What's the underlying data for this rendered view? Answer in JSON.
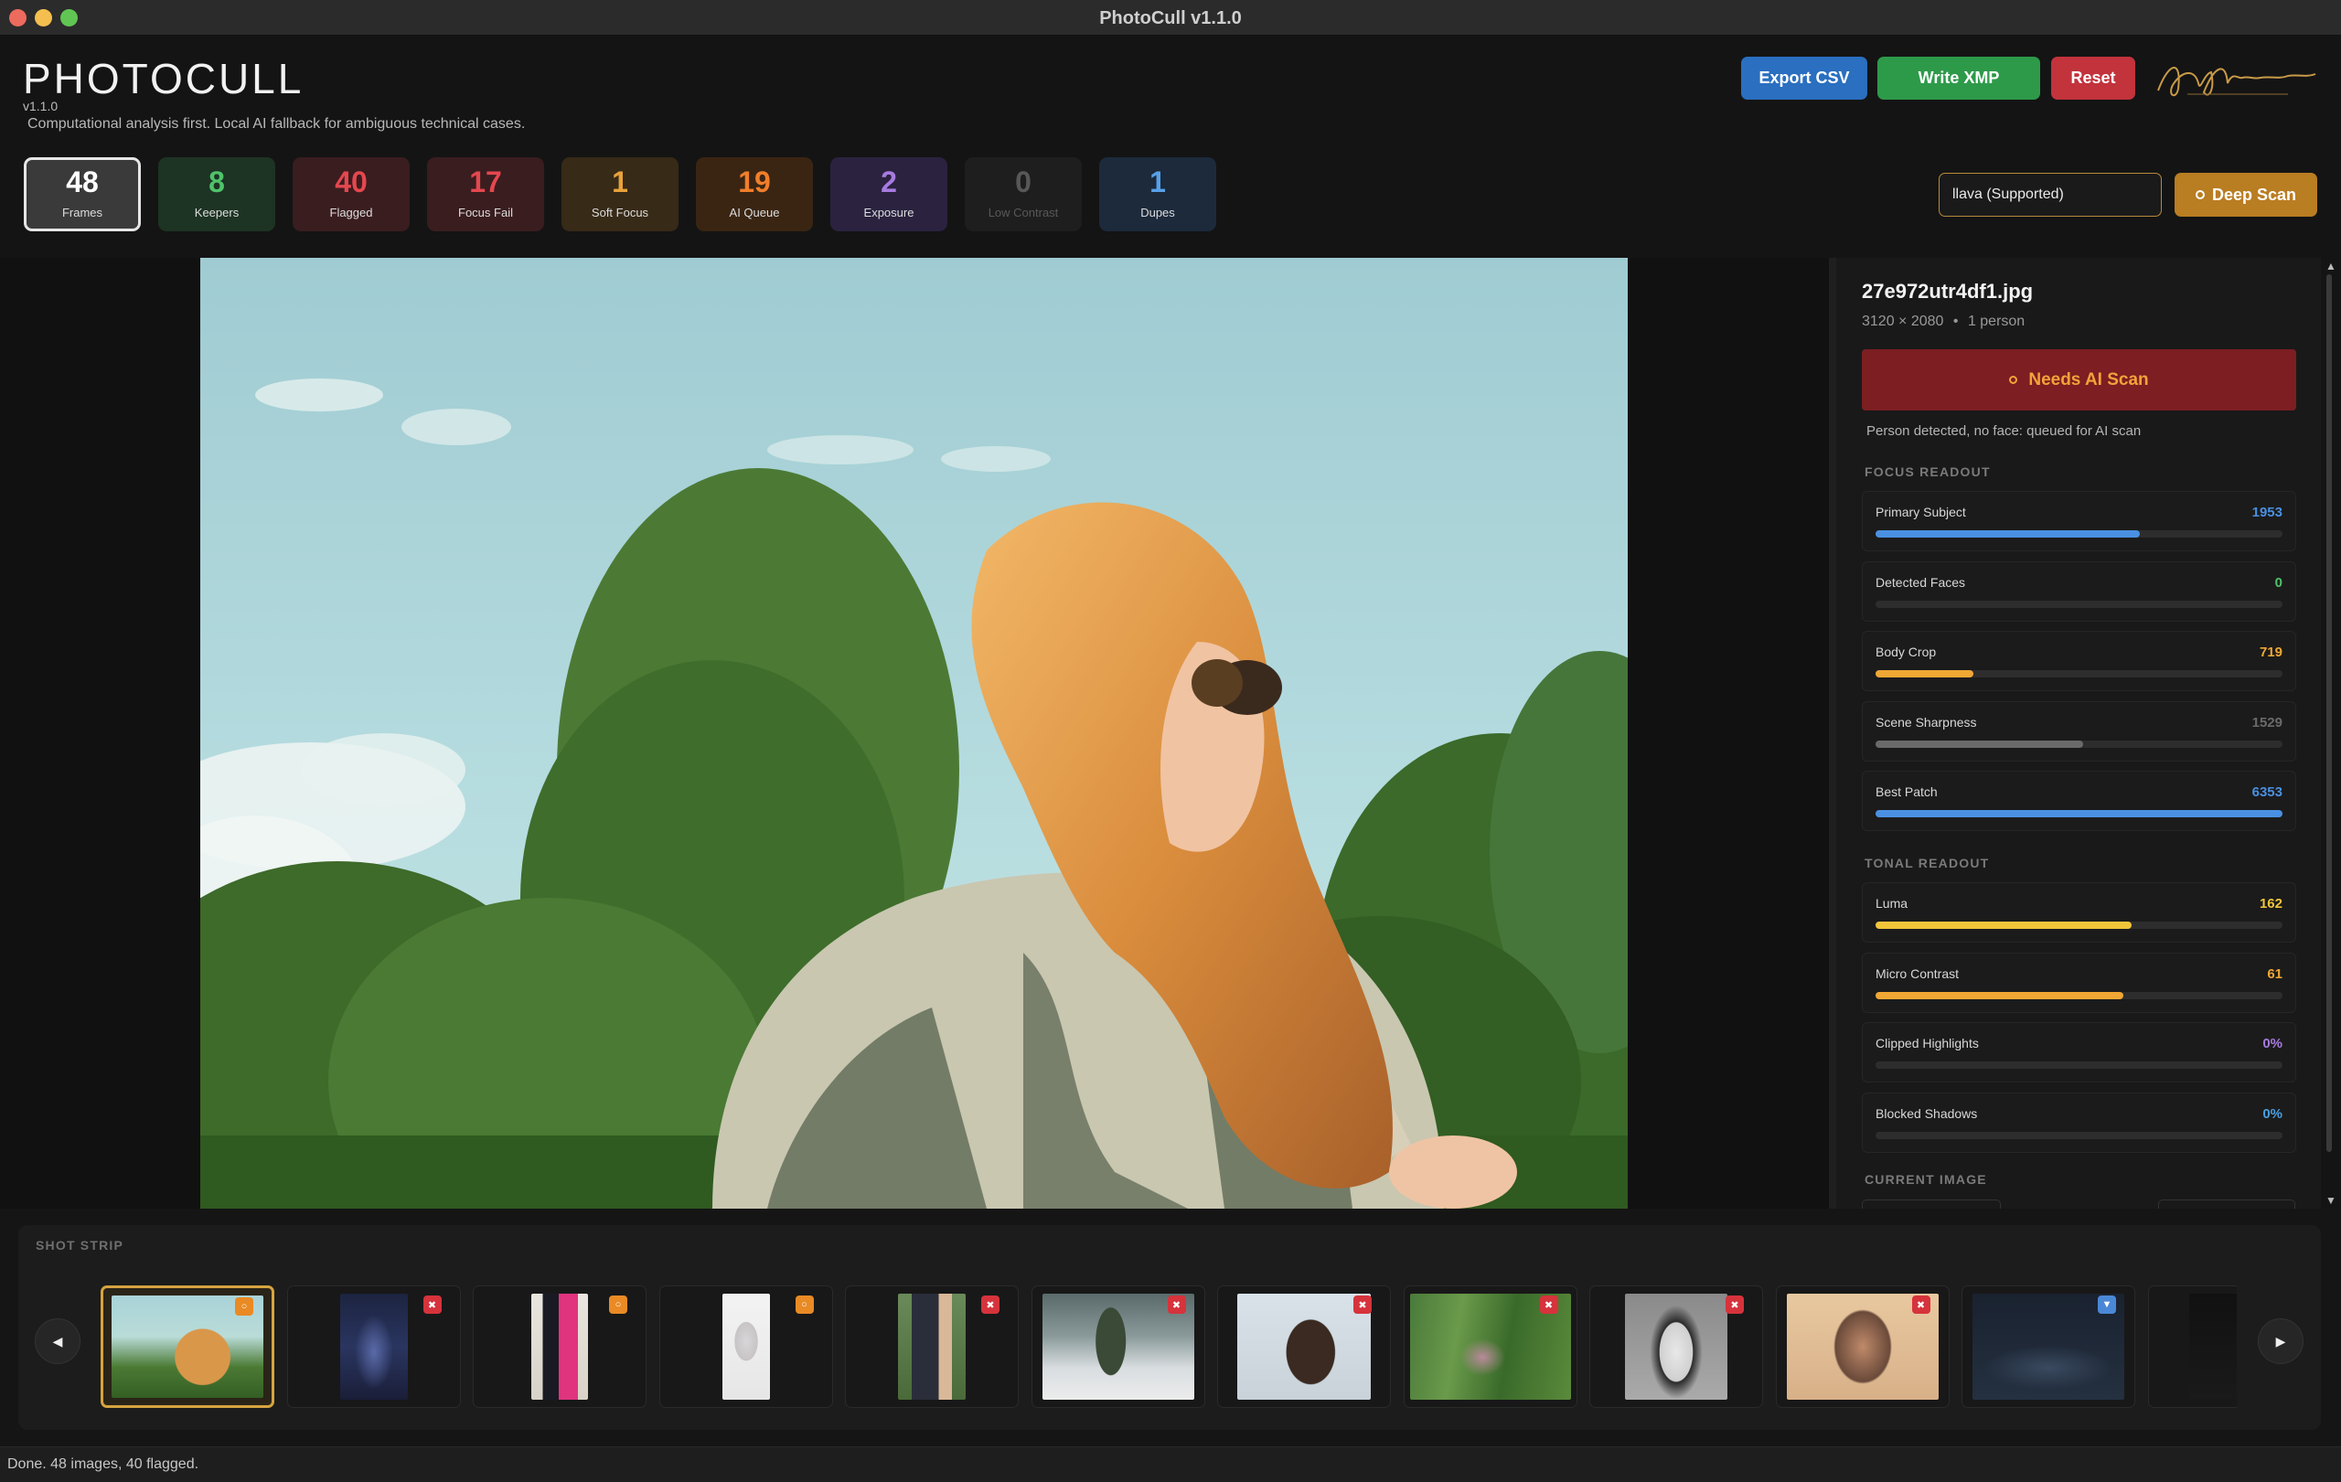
{
  "window": {
    "title": "PhotoCull v1.1.0"
  },
  "app": {
    "name": "PHOTOCULL",
    "version": "v1.1.0",
    "tagline": "Computational analysis first. Local AI fallback for ambiguous technical cases."
  },
  "toolbar": {
    "export_label": "Export CSV",
    "xmp_label": "Write XMP",
    "reset_label": "Reset",
    "export_color": "#2a6fc0",
    "xmp_color": "#2d9a4a",
    "reset_color": "#c2333c"
  },
  "stats": [
    {
      "value": "48",
      "label": "Frames",
      "color": "#ffffff",
      "bg": "#3a3a3a",
      "selected": true
    },
    {
      "value": "8",
      "label": "Keepers",
      "color": "#4fc36a",
      "bg": "#1d3323"
    },
    {
      "value": "40",
      "label": "Flagged",
      "color": "#e5474f",
      "bg": "#3a1d1f"
    },
    {
      "value": "17",
      "label": "Focus Fail",
      "color": "#e5474f",
      "bg": "#3a1d1f"
    },
    {
      "value": "1",
      "label": "Soft Focus",
      "color": "#e8a23b",
      "bg": "#372a17"
    },
    {
      "value": "19",
      "label": "AI Queue",
      "color": "#f07e2a",
      "bg": "#3a2513"
    },
    {
      "value": "2",
      "label": "Exposure",
      "color": "#a77be0",
      "bg": "#2b2240"
    },
    {
      "value": "0",
      "label": "Low Contrast",
      "color": "#585858",
      "bg": "#1e1e1e"
    },
    {
      "value": "1",
      "label": "Dupes",
      "color": "#58a0e8",
      "bg": "#1c2a3c"
    }
  ],
  "model": {
    "value": "llava (Supported)"
  },
  "deep_scan": {
    "label": "Deep Scan",
    "color": "#b97d22"
  },
  "inspector": {
    "filename": "27e972utr4df1.jpg",
    "dimensions": "3120 × 2080",
    "separator": "•",
    "persons": "1 person",
    "ai_button": "Needs AI Scan",
    "ai_note": "Person detected, no face: queued for AI scan",
    "focus_title": "FOCUS READOUT",
    "tonal_title": "TONAL READOUT",
    "current_title": "CURRENT IMAGE",
    "focus": [
      {
        "label": "Primary Subject",
        "value": "1953",
        "fraction": 0.65,
        "color": "#4a90e2"
      },
      {
        "label": "Detected Faces",
        "value": "0",
        "fraction": 0.0,
        "color": "#4fc36a"
      },
      {
        "label": "Body Crop",
        "value": "719",
        "fraction": 0.24,
        "color": "#f0a734"
      },
      {
        "label": "Scene Sharpness",
        "value": "1529",
        "fraction": 0.51,
        "color": "#6a6a6a"
      },
      {
        "label": "Best Patch",
        "value": "6353",
        "fraction": 1.0,
        "color": "#4a90e2"
      }
    ],
    "tonal": [
      {
        "label": "Luma",
        "value": "162",
        "fraction": 0.63,
        "color": "#f0c53a"
      },
      {
        "label": "Micro Contrast",
        "value": "61",
        "fraction": 0.61,
        "color": "#f0a734"
      },
      {
        "label": "Clipped Highlights",
        "value": "0%",
        "fraction": 0.0,
        "color": "#a77be0"
      },
      {
        "label": "Blocked Shadows",
        "value": "0%",
        "fraction": 0.0,
        "color": "#4a9fe0"
      }
    ]
  },
  "strip": {
    "title": "SHOT STRIP",
    "prev_icon": "chevron-left-icon",
    "next_icon": "chevron-right-icon",
    "thumbs": [
      {
        "scene": "woman-trees",
        "badge": "ai",
        "selected": true
      },
      {
        "scene": "stage",
        "badge": "fail"
      },
      {
        "scene": "couple-pink",
        "badge": "ai"
      },
      {
        "scene": "baby-doc",
        "badge": "ai"
      },
      {
        "scene": "couple-green",
        "badge": "fail"
      },
      {
        "scene": "hockey",
        "badge": "fail"
      },
      {
        "scene": "woman-smile",
        "badge": "fail"
      },
      {
        "scene": "motion-blur",
        "badge": "fail"
      },
      {
        "scene": "bw-portrait",
        "badge": "fail"
      },
      {
        "scene": "man-glasses",
        "badge": "fail"
      },
      {
        "scene": "crowd-dark",
        "badge": "dupe"
      },
      {
        "scene": "dark",
        "badge": "none"
      }
    ]
  },
  "status": {
    "text": "Done. 48 images, 40 flagged."
  }
}
